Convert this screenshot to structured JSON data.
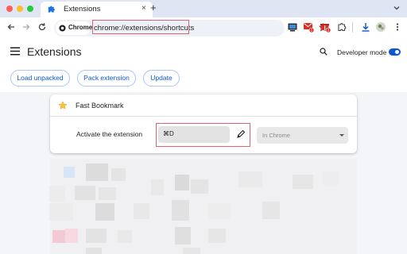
{
  "browser": {
    "tab": {
      "title": "Extensions",
      "close": "×"
    },
    "new_tab": "+",
    "omnibox": {
      "chip_label": "Chrome",
      "url": "chrome://extensions/shortcuts"
    },
    "extension_badges": [
      "1",
      "2"
    ]
  },
  "page": {
    "title": "Extensions",
    "developer_mode": {
      "label": "Developer mode",
      "enabled": true
    },
    "buttons": {
      "load_unpacked": "Load unpacked",
      "pack_extension": "Pack extension",
      "update": "Update"
    }
  },
  "card": {
    "extension_name": "Fast Bookmark",
    "command_label": "Activate the extension",
    "shortcut_value": "⌘D",
    "scope_value": "In Chrome"
  },
  "colors": {
    "accent": "#0b57d0",
    "highlight_box": "#e06370",
    "tab_strip": "#dfe5f3",
    "page_bg": "#f4f5f9"
  }
}
